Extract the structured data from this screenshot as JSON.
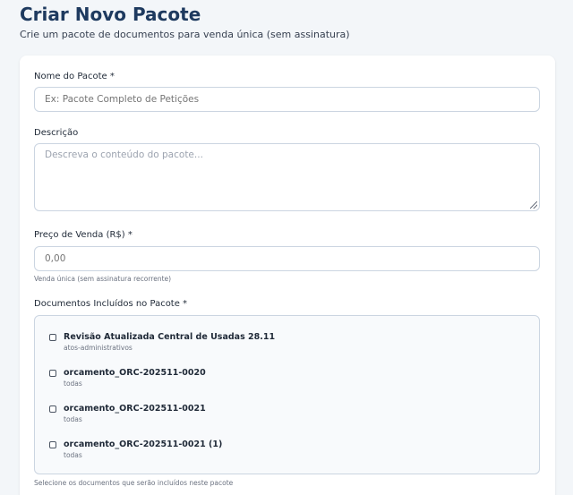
{
  "header": {
    "title": "Criar Novo Pacote",
    "subtitle": "Crie um pacote de documentos para venda única (sem assinatura)"
  },
  "form": {
    "name": {
      "label": "Nome do Pacote *",
      "placeholder": "Ex: Pacote Completo de Petições",
      "value": ""
    },
    "description": {
      "label": "Descrição",
      "placeholder": "Descreva o conteúdo do pacote...",
      "value": ""
    },
    "price": {
      "label": "Preço de Venda (R$) *",
      "placeholder": "0,00",
      "value": "",
      "hint": "Venda única (sem assinatura recorrente)"
    },
    "documents": {
      "label": "Documentos Incluídos no Pacote *",
      "hint": "Selecione os documentos que serão incluídos neste pacote",
      "items": [
        {
          "name": "Revisão Atualizada Central de Usadas 28.11",
          "category": "atos-administrativos",
          "checked": false
        },
        {
          "name": "orcamento_ORC-202511-0020",
          "category": "todas",
          "checked": false
        },
        {
          "name": "orcamento_ORC-202511-0021",
          "category": "todas",
          "checked": false
        },
        {
          "name": "orcamento_ORC-202511-0021 (1)",
          "category": "todas",
          "checked": false
        }
      ]
    }
  }
}
